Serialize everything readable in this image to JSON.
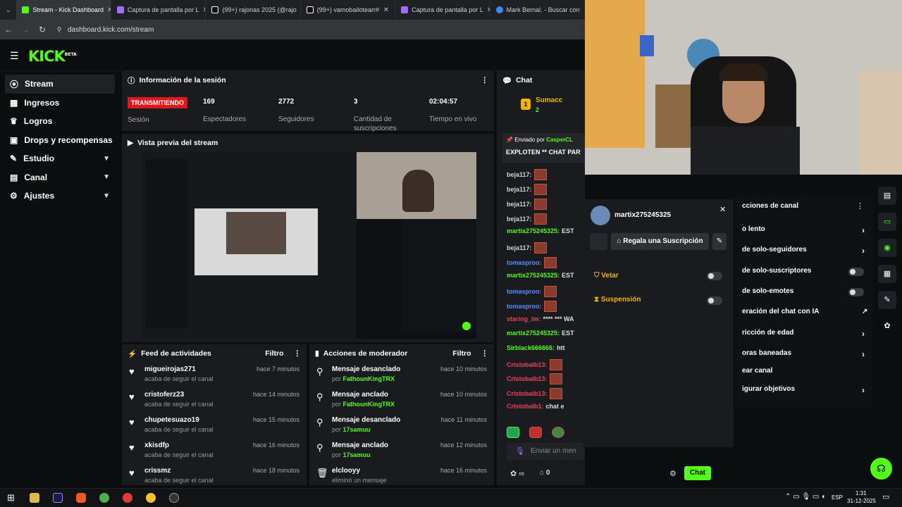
{
  "browser": {
    "tabs": [
      {
        "label": "Stream - Kick Dashboard",
        "color": "#53fc18"
      },
      {
        "label": "Captura de pantalla por L",
        "color": "#a66bff"
      },
      {
        "label": "(99+) rajonas 2025 (@rajo",
        "color": "#ffffff"
      },
      {
        "label": "(99+) vamobailotearr#",
        "color": "#ffffff"
      },
      {
        "label": "Captura de pantalla por L",
        "color": "#a66bff"
      },
      {
        "label": "Mark Bernal. - Buscar con",
        "color": "#4285f4"
      }
    ],
    "url": "dashboard.kick.com/stream"
  },
  "brand": {
    "logo": "KICK",
    "beta": "BETA"
  },
  "sidebar": {
    "items": [
      {
        "label": "Stream",
        "icon": "broadcast-icon"
      },
      {
        "label": "Ingresos",
        "icon": "money-icon"
      },
      {
        "label": "Logros",
        "icon": "trophy-icon"
      },
      {
        "label": "Drops y recompensas",
        "icon": "gift-icon"
      },
      {
        "label": "Estudio",
        "icon": "studio-icon"
      },
      {
        "label": "Canal",
        "icon": "channel-icon"
      },
      {
        "label": "Ajustes",
        "icon": "gear-icon"
      }
    ]
  },
  "session": {
    "title": "Información de la sesión",
    "status": "TRANSMITIENDO",
    "status_label": "Sesión",
    "stats": [
      {
        "value": "169",
        "label": "Espectadores"
      },
      {
        "value": "2772",
        "label": "Seguidores"
      },
      {
        "value": "3",
        "label": "Cantidad de suscripciones"
      },
      {
        "value": "02:04:57",
        "label": "Tiempo en vivo"
      }
    ]
  },
  "preview": {
    "title": "Vista previa del stream"
  },
  "feed": {
    "title": "Feed de actividades",
    "filter": "Filtro",
    "items": [
      {
        "name": "migueirojas271",
        "sub": "acaba de seguir el canal",
        "time": "hace 7 minutos"
      },
      {
        "name": "cristoferz23",
        "sub": "acaba de seguir el canal",
        "time": "hace 14 minutos"
      },
      {
        "name": "chupetesuazo19",
        "sub": "acaba de seguir el canal",
        "time": "hace 15 minutos"
      },
      {
        "name": "xkisdfp",
        "sub": "acaba de seguir el canal",
        "time": "hace 16 minutos"
      },
      {
        "name": "crissmz",
        "sub": "acaba de seguir el canal",
        "time": "hace 18 minutos"
      }
    ]
  },
  "modactions": {
    "title": "Acciones de moderador",
    "filter": "Filtro",
    "items": [
      {
        "name": "Mensaje desanclado",
        "by": "por",
        "user": "FathounKingTRX",
        "time": "hace 10 minutos",
        "icon": "unpin-icon"
      },
      {
        "name": "Mensaje anclado",
        "by": "por",
        "user": "FathounKingTRX",
        "time": "hace 10 minutos",
        "icon": "pin-icon"
      },
      {
        "name": "Mensaje desanclado",
        "by": "por",
        "user": "17samuu",
        "time": "hace 11 minutos",
        "icon": "unpin-icon"
      },
      {
        "name": "Mensaje anclado",
        "by": "por",
        "user": "17samuu",
        "time": "hace 12 minutos",
        "icon": "pin-icon"
      },
      {
        "name": "elclooyy",
        "by": "eliminó un mensaje",
        "user": "",
        "time": "hace 16 minutos",
        "icon": "trash-icon"
      }
    ]
  },
  "chat": {
    "title": "Chat",
    "top_user": "Sumacc",
    "top_rank": "1",
    "top_count": "2",
    "pinned_by": "Enviado por",
    "pinned_user": "CasperCL",
    "pinned_text": "EXPLOTEN ** CHAT PAR",
    "messages": [
      {
        "user": "beja117:",
        "color": "#d0d0d0",
        "text": ""
      },
      {
        "user": "beja117:",
        "color": "#d0d0d0",
        "text": ""
      },
      {
        "user": "beja117:",
        "color": "#d0d0d0",
        "text": ""
      },
      {
        "user": "beja117:",
        "color": "#d0d0d0",
        "text": ""
      },
      {
        "user": "martix275245325:",
        "color": "#53fc18",
        "text": "EST"
      },
      {
        "user": "beja117:",
        "color": "#d0d0d0",
        "text": ""
      },
      {
        "user": "tomasproo:",
        "color": "#5b8cff",
        "text": ""
      },
      {
        "user": "martix275245325:",
        "color": "#53fc18",
        "text": "EST"
      },
      {
        "user": "tomasproo:",
        "color": "#5b8cff",
        "text": ""
      },
      {
        "user": "tomasproo:",
        "color": "#5b8cff",
        "text": ""
      },
      {
        "user": "staring_lm:",
        "color": "#e0455a",
        "text": "**** *** WA"
      },
      {
        "user": "martix275245325:",
        "color": "#53fc18",
        "text": "EST"
      },
      {
        "user": "Sirblack666666:",
        "color": "#53fc18",
        "text": "htt"
      },
      {
        "user": "Cristobalb13:",
        "color": "#e0455a",
        "text": ""
      },
      {
        "user": "Cristobalb13:",
        "color": "#e0455a",
        "text": ""
      },
      {
        "user": "Cristobalb13:",
        "color": "#e0455a",
        "text": ""
      },
      {
        "user": "Cristobalb1:",
        "color": "#e0455a",
        "text": "chat e"
      }
    ],
    "input_placeholder": "Enviar un men",
    "points": "∞",
    "gifts": "0",
    "send": "Chat"
  },
  "usercard": {
    "username": "martix275245325",
    "gift_sub": "Regala una Suscripción",
    "actions": [
      {
        "label": "Vetar"
      },
      {
        "label": "Suspensión"
      }
    ]
  },
  "rightpanel": {
    "title": "cciones de canal",
    "items": [
      {
        "label": "o lento",
        "type": "chevron"
      },
      {
        "label": "de solo-seguidores",
        "type": "chevron"
      },
      {
        "label": "de solo-suscriptores",
        "type": "toggle"
      },
      {
        "label": "de solo-emotes",
        "type": "toggle"
      },
      {
        "label": "eración del chat con IA",
        "type": "external"
      },
      {
        "label": "ricción de edad",
        "type": "chevron"
      },
      {
        "label": "oras baneadas",
        "type": "chevron"
      },
      {
        "label": "ear canal",
        "type": "none"
      },
      {
        "label": "igurar objetivos",
        "type": "chevron"
      }
    ]
  },
  "taskbar": {
    "lang": "ESP",
    "time": "1:31",
    "date": "31-12-2025"
  }
}
